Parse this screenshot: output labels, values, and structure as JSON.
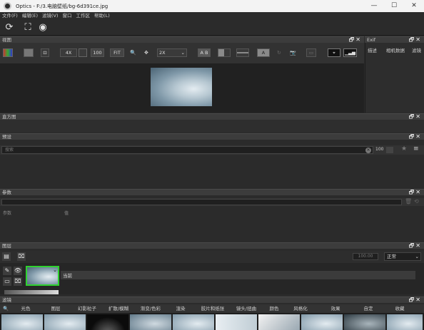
{
  "window": {
    "title": "Optics - F:/3.电脑壁纸/bg-6d391ce.jpg",
    "minimize": "—",
    "maximize": "☐",
    "close": "✕"
  },
  "menu": [
    "文件(F)",
    "编辑(E)",
    "滤镜(V)",
    "窗口",
    "工作区",
    "帮助(L)"
  ],
  "toolbar": {
    "icons": [
      "refresh-icon",
      "crop-icon",
      "camera-rotate-icon"
    ]
  },
  "panels": {
    "viewer": "视图",
    "exif": "Exif",
    "histogram": "直方图",
    "presets": "预设",
    "params": "参数",
    "layers": "图层",
    "filters": "滤镜"
  },
  "panel_controls": "🗗✕",
  "viewer_bar": {
    "zoom_in": "4X",
    "fit_100": "100",
    "fit": "FIT",
    "zoom_select": "2X",
    "ab_label": "A B",
    "a_label": "A"
  },
  "exif_tabs": [
    "描述",
    "相机数据",
    "滤镜"
  ],
  "presets": {
    "search_placeholder": "搜索",
    "size_value": "100"
  },
  "params_cols": [
    "参数",
    "值"
  ],
  "layers": {
    "opacity_value": "100.00",
    "blend_mode": "正常",
    "layer_name": "当前"
  },
  "filter_tabs": [
    "光色",
    "图层",
    "幻影粒子",
    "扩散/模糊",
    "渐变/色彩",
    "渲染",
    "胶片和纸张",
    "镜头/扭曲",
    "颜色",
    "风格化",
    "效果",
    "自定",
    "收藏"
  ],
  "colors": {
    "accent_green": "#2fd12f",
    "bg": "#2b2b2b",
    "panel_header": "#3c3c3c"
  }
}
